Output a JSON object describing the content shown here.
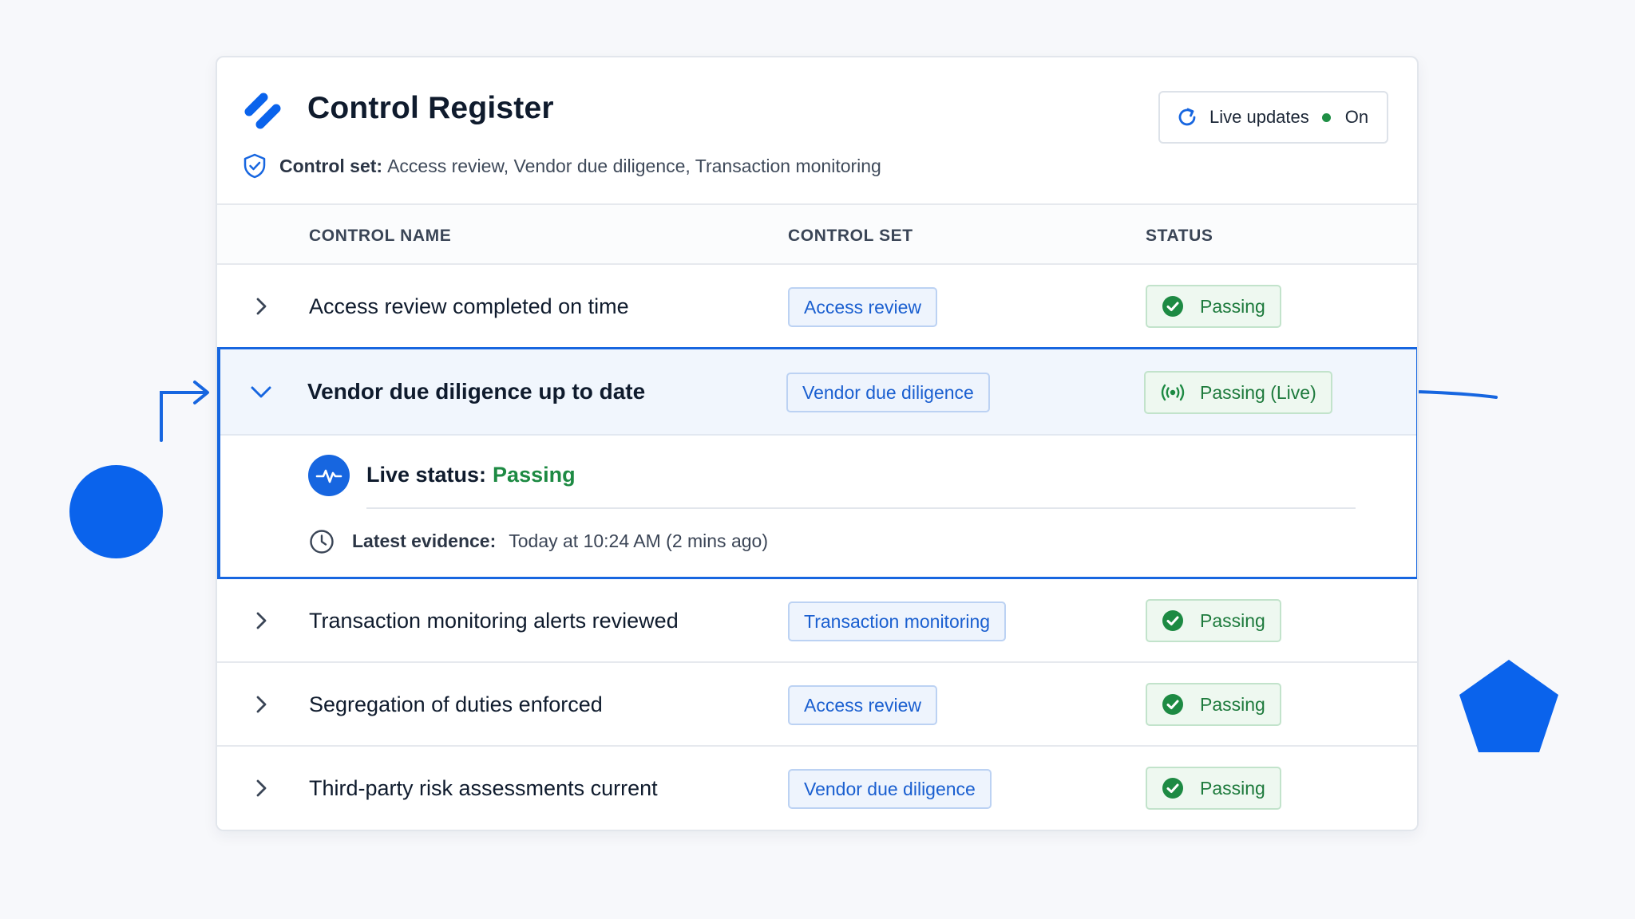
{
  "header": {
    "title": "Control Register",
    "control_set_label": "Control set:",
    "control_set_value": "Access review, Vendor due diligence, Transaction monitoring",
    "live_updates_label": "Live updates",
    "live_updates_state": "On"
  },
  "columns": {
    "name": "CONTROL NAME",
    "set": "CONTROL SET",
    "status": "STATUS"
  },
  "rows": [
    {
      "name": "Access review completed on time",
      "set": "Access review",
      "status": "Passing"
    },
    {
      "name": "Vendor due diligence up to date",
      "set": "Vendor due diligence",
      "status": "Passing (Live)",
      "expanded": true
    },
    {
      "name": "Transaction monitoring alerts reviewed",
      "set": "Transaction monitoring",
      "status": "Passing"
    },
    {
      "name": "Segregation of duties enforced",
      "set": "Access review",
      "status": "Passing"
    },
    {
      "name": "Third-party risk assessments current",
      "set": "Vendor due diligence",
      "status": "Passing"
    }
  ],
  "detail": {
    "live_status_label": "Live status:",
    "live_status_value": "Passing",
    "evidence_label": "Latest evidence:",
    "evidence_value": "Today at 10:24 AM (2 mins ago)"
  },
  "icons": {
    "logo": "app-logo-icon",
    "shield": "shield-check-icon",
    "refresh": "refresh-icon",
    "chevron_right": "chevron-right-icon",
    "chevron_down": "chevron-down-icon",
    "check": "check-circle-icon",
    "live": "broadcast-icon",
    "pulse": "pulse-icon",
    "clock": "clock-icon"
  },
  "colors": {
    "accent": "#0a63ec",
    "passing": "#1d8a43",
    "tag_text": "#1a5fd0"
  }
}
